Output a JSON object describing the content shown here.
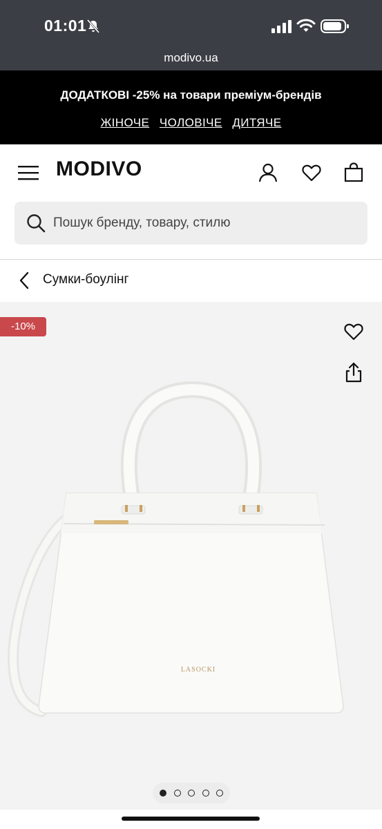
{
  "status_bar": {
    "time": "01:01",
    "url": "modivo.ua"
  },
  "promo": {
    "title": "ДОДАТКОВІ -25% на товари преміум-брендів",
    "links": [
      "ЖІНОЧЕ",
      "ЧОЛОВІЧЕ",
      "ДИТЯЧЕ"
    ]
  },
  "header": {
    "logo": "MODIVO",
    "icons": [
      "menu-icon",
      "user-icon",
      "heart-icon",
      "shopping-bag-icon"
    ]
  },
  "search": {
    "placeholder": "Пошук бренду, товару, стилю",
    "value": ""
  },
  "breadcrumb": {
    "label": "Сумки-боулінг"
  },
  "product": {
    "discount_badge": "-10%",
    "image_brand_text": "LASOCKI",
    "carousel": {
      "total": 5,
      "active_index": 0
    }
  },
  "colors": {
    "status_bar_bg": "#3b3f45",
    "promo_bg": "#000000",
    "badge_bg": "#c9484c",
    "gallery_bg": "#f3f3f3",
    "search_bg": "#eeeeee"
  }
}
